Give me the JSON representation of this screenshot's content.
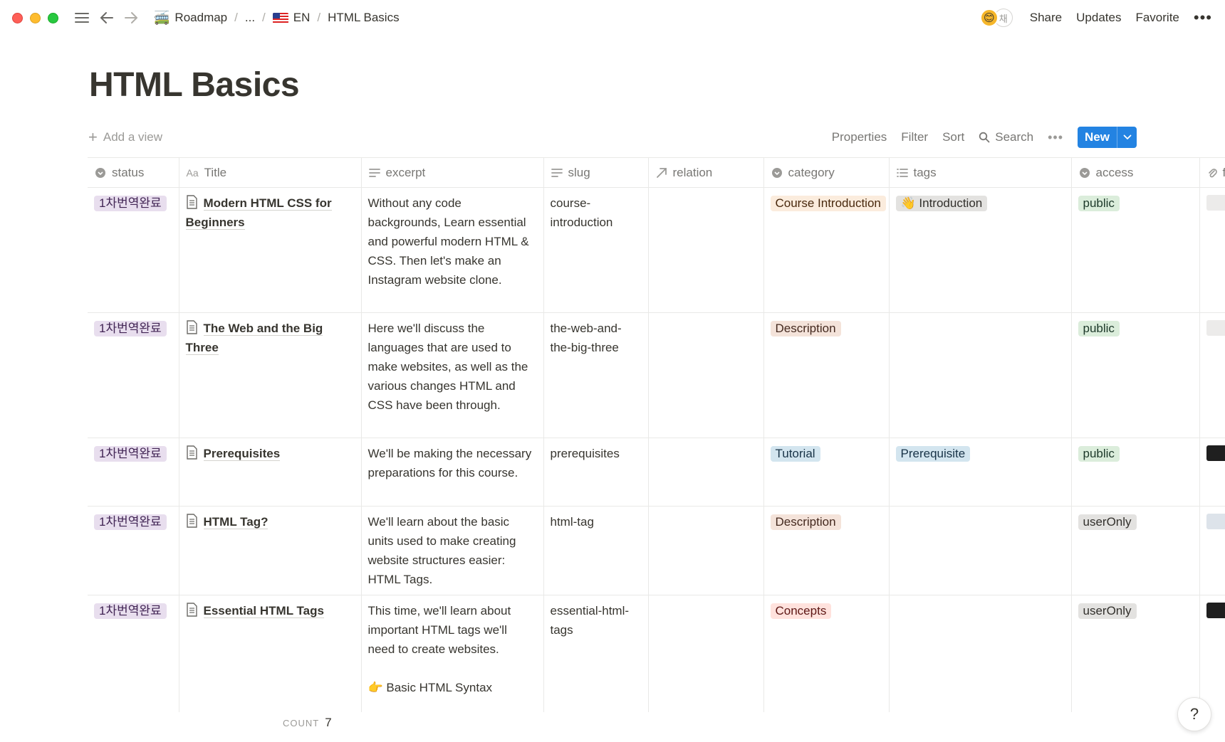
{
  "breadcrumb": {
    "root_emoji": "🚎",
    "root": "Roadmap",
    "ellipsis": "...",
    "lang": "EN",
    "current": "HTML Basics"
  },
  "topbar": {
    "avatar_initial": "채",
    "share": "Share",
    "updates": "Updates",
    "favorite": "Favorite",
    "more": "•••"
  },
  "page": {
    "title": "HTML Basics"
  },
  "viewbar": {
    "add_view": "Add a view",
    "properties": "Properties",
    "filter": "Filter",
    "sort": "Sort",
    "search": "Search",
    "more": "•••",
    "new": "New"
  },
  "columns": {
    "status": "status",
    "title": "Title",
    "excerpt": "excerpt",
    "slug": "slug",
    "relation": "relation",
    "category": "category",
    "tags": "tags",
    "access": "access",
    "files": "f"
  },
  "rows": [
    {
      "status": "1차번역완료",
      "title": "Modern HTML CSS for Beginners",
      "excerpt": "Without any code backgrounds, Learn essential and powerful modern HTML & CSS. Then let's make an Instagram website clone.",
      "excerpt_extra": "",
      "slug": "course-introduction",
      "category": "Course Introduction",
      "tag": "👋 Introduction",
      "access": "public"
    },
    {
      "status": "1차번역완료",
      "title": "The Web and the Big Three",
      "excerpt": "Here we'll discuss the languages that are used to make websites, as well as the various changes HTML and CSS have been through.",
      "excerpt_extra": "",
      "slug": "the-web-and-the-big-three",
      "category": "Description",
      "tag": "",
      "access": "public"
    },
    {
      "status": "1차번역완료",
      "title": "Prerequisites",
      "excerpt": "We'll be making the necessary preparations for this course.",
      "excerpt_extra": "",
      "slug": "prerequisites",
      "category": "Tutorial",
      "tag": "Prerequisite",
      "access": "public"
    },
    {
      "status": "1차번역완료",
      "title": "HTML Tag?",
      "excerpt": "We'll learn about the basic units used to make creating website structures easier: HTML Tags.",
      "excerpt_extra": "",
      "slug": "html-tag",
      "category": "Description",
      "tag": "",
      "access": "userOnly"
    },
    {
      "status": "1차번역완료",
      "title": "Essential HTML Tags",
      "excerpt": "This time, we'll learn about important HTML tags we'll need to create websites.",
      "excerpt_extra": "👉 Basic HTML Syntax",
      "slug": "essential-html-tags",
      "category": "Concepts",
      "tag": "",
      "access": "userOnly"
    }
  ],
  "footer": {
    "count_label": "COUNT",
    "count_value": "7"
  },
  "help": "?"
}
